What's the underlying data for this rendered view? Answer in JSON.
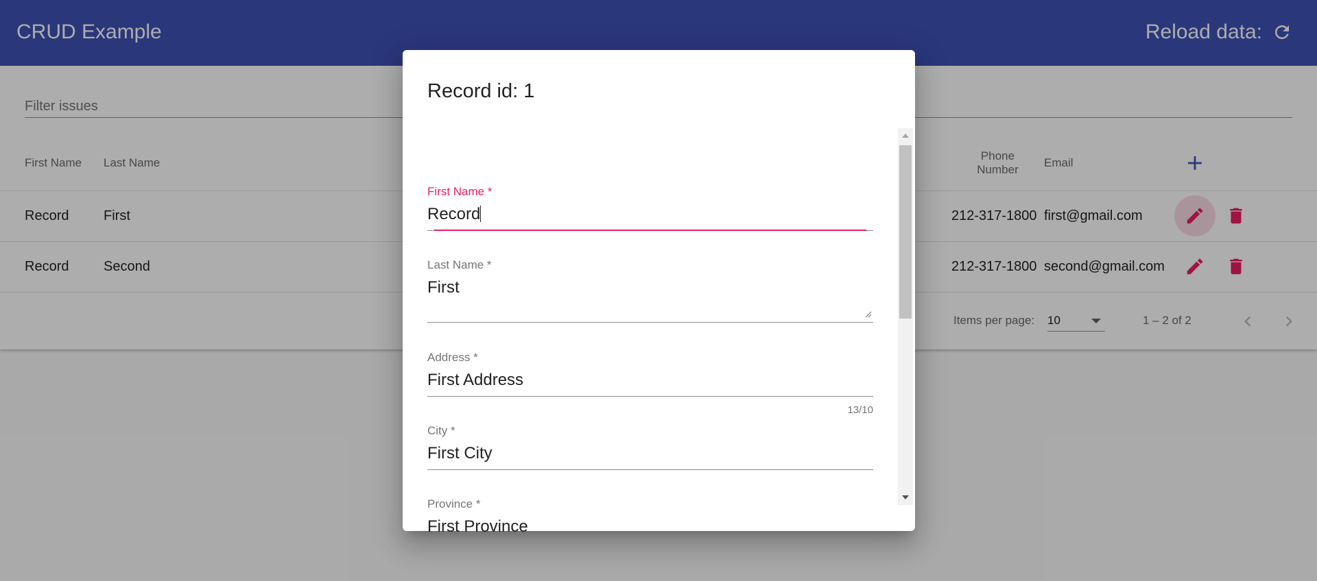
{
  "app": {
    "title": "CRUD Example",
    "reload_label": "Reload data:",
    "primary_color": "#3f51b5",
    "accent_color": "#e91e63"
  },
  "filter": {
    "placeholder": "Filter issues",
    "value": ""
  },
  "table": {
    "columns": [
      "First Name",
      "Last Name",
      "Phone Number",
      "Email"
    ],
    "add_icon": "plus-icon",
    "rows": [
      {
        "first_name": "Record",
        "last_name": "First",
        "phone": "212-317-1800",
        "email": "first@gmail.com"
      },
      {
        "first_name": "Record",
        "last_name": "Second",
        "phone": "212-317-1800",
        "email": "second@gmail.com"
      }
    ]
  },
  "paginator": {
    "items_per_page_label": "Items per page:",
    "items_per_page_value": "10",
    "range_label": "1 – 2 of 2"
  },
  "dialog": {
    "title": "Record id: 1",
    "fields": [
      {
        "label": "First Name *",
        "value": "Record",
        "focused": true
      },
      {
        "label": "Last Name *",
        "value": "First"
      },
      {
        "label": "Address *",
        "value": "First Address",
        "hint": "13/10"
      },
      {
        "label": "City *",
        "value": "First City"
      },
      {
        "label": "Province *",
        "value": "First Province"
      }
    ]
  }
}
